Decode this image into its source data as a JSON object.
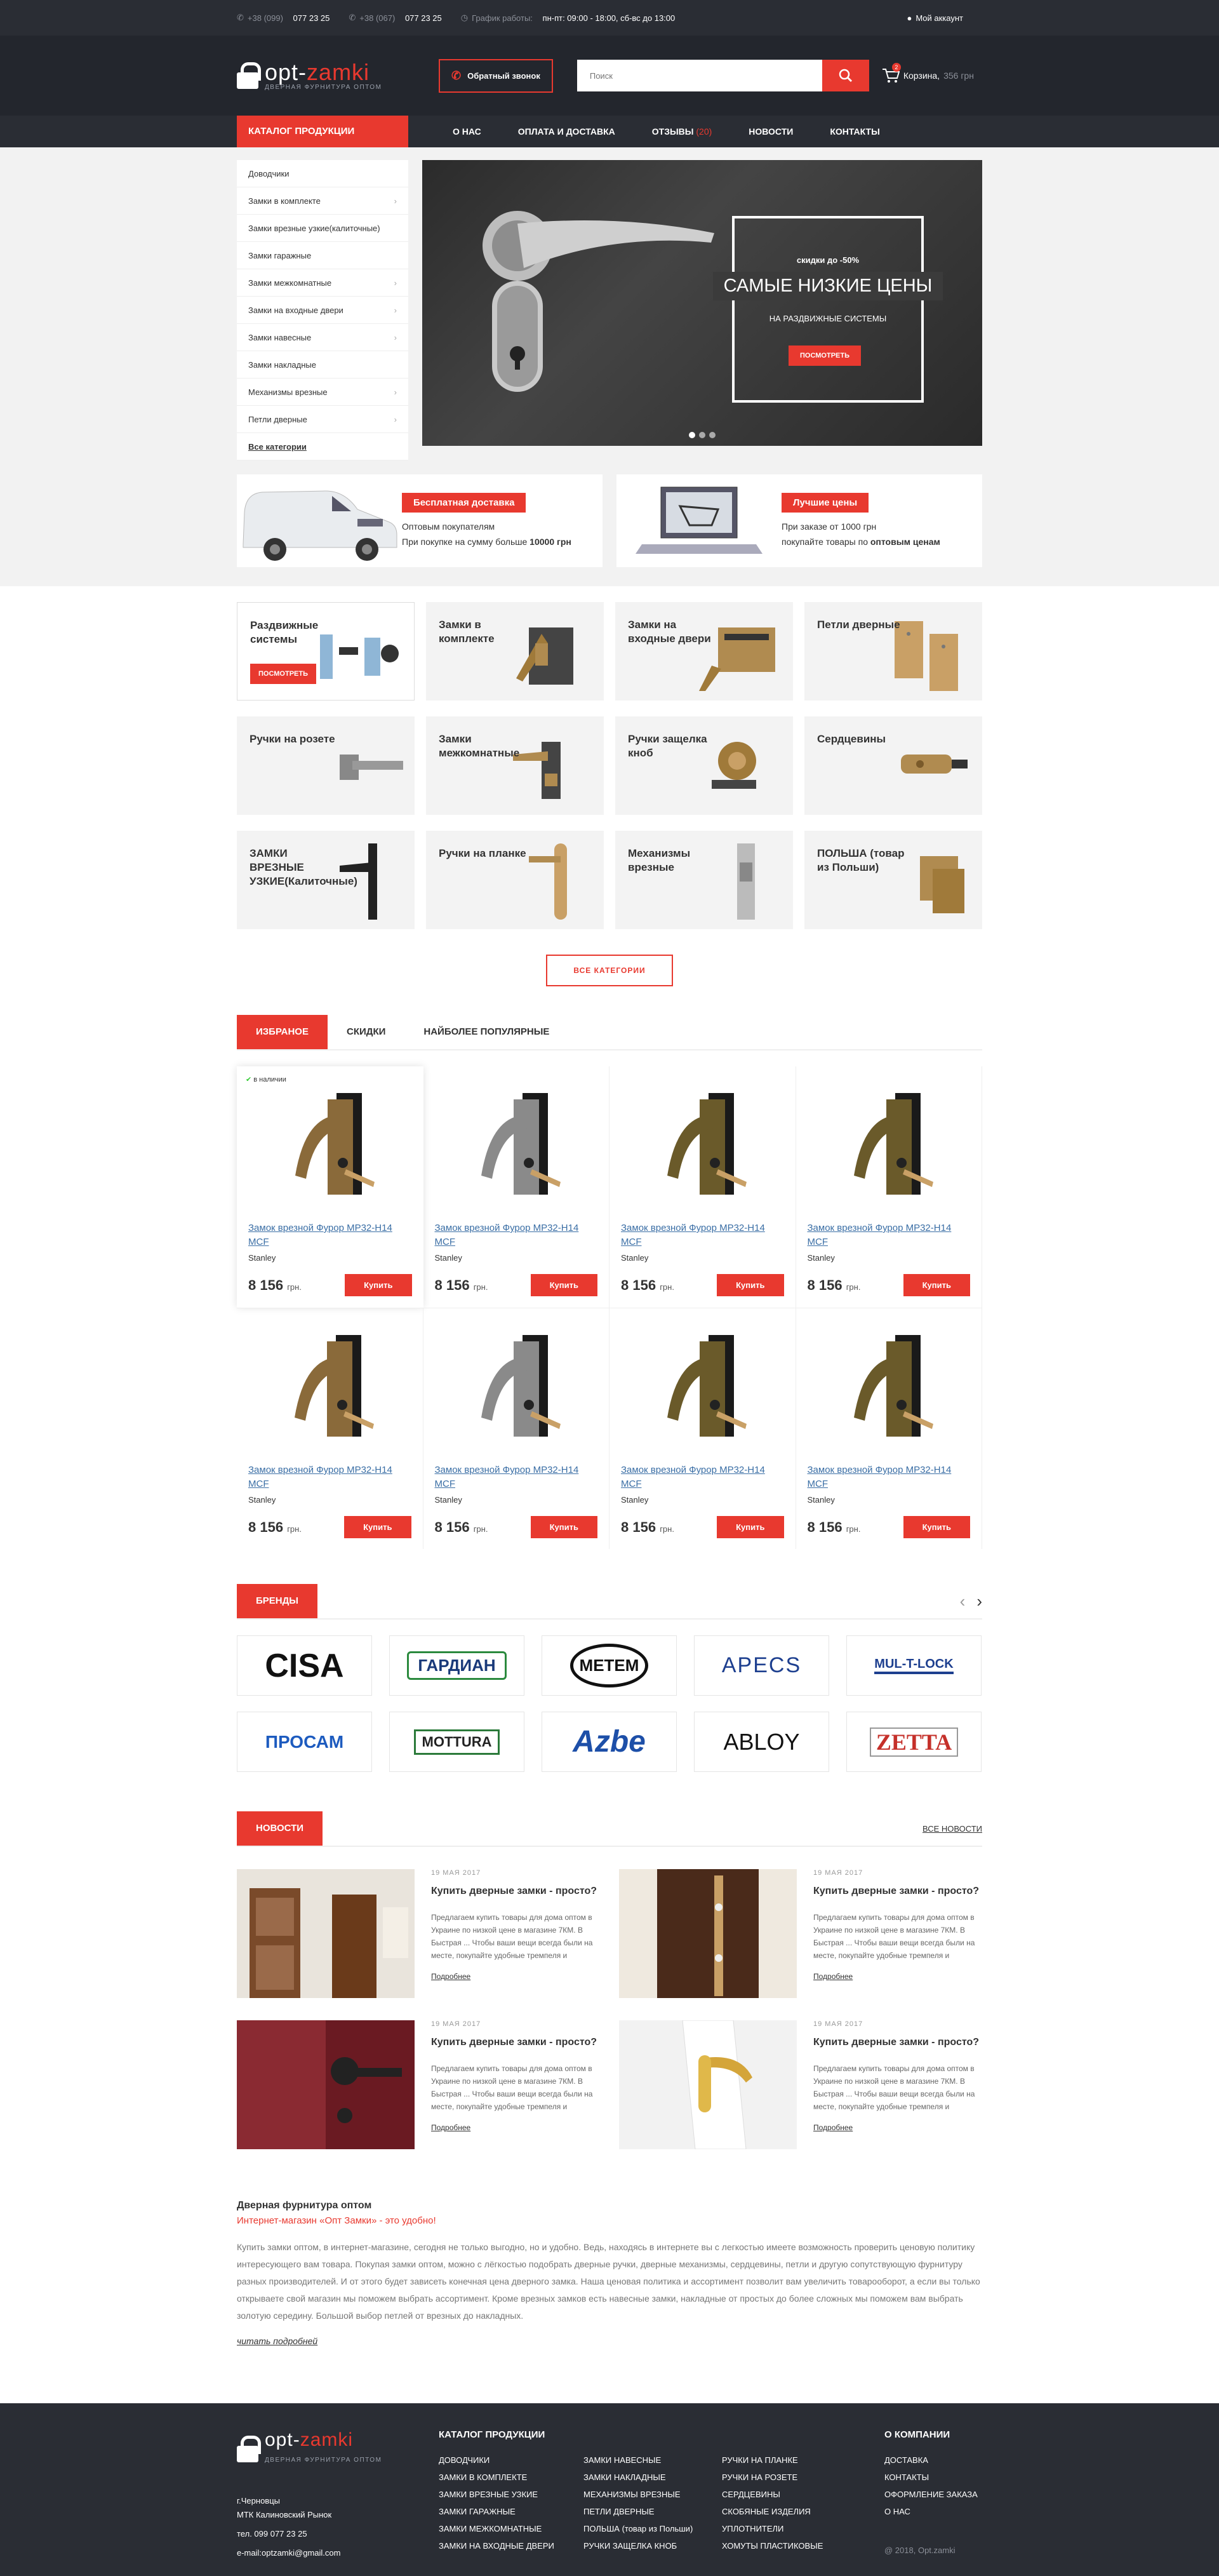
{
  "topbar": {
    "phone1_prefix": "+38 (099)",
    "phone1": "077 23 25",
    "phone2_prefix": "+38 (067)",
    "phone2": "077 23 25",
    "schedule_label": "График работы:",
    "schedule": "пн-пт: 09:00 - 18:00, сб-вс до 13:00",
    "account": "Мой аккаунт"
  },
  "header": {
    "logo_a": "opt-",
    "logo_b": "zamki",
    "logo_sub": "ДВЕРНАЯ ФУРНИТУРА ОПТОМ",
    "callback": "Обратный звонок",
    "search_placeholder": "Поиск",
    "cart_count": "2",
    "cart_label": "Корзина,",
    "cart_sum": "356 грн"
  },
  "nav": {
    "catalog": "КАТАЛОГ ПРОДУКЦИИ",
    "items": [
      "О НАС",
      "ОПЛАТА И ДОСТАВКА",
      "ОТЗЫВЫ",
      "НОВОСТИ",
      "КОНТАКТЫ"
    ],
    "reviews_count": "(20)"
  },
  "sidebar": {
    "items": [
      "Доводчики",
      "Замки в комплекте",
      "Замки врезные узкие(калиточные)",
      "Замки гаражные",
      "Замки межкомнатные",
      "Замки на входные двери",
      "Замки навесные",
      "Замки накладные",
      "Механизмы врезные",
      "Петли дверные"
    ],
    "all": "Все категории"
  },
  "slider": {
    "line1": "скидки до -50%",
    "line2": "САМЫЕ НИЗКИЕ ЦЕНЫ",
    "line3": "НА РАЗДВИЖНЫЕ СИСТЕМЫ",
    "button": "ПОСМОТРЕТЬ"
  },
  "promo": [
    {
      "tag": "Бесплатная доставка",
      "l1": "Оптовым покупателям",
      "l2a": "При покупке на сумму больше ",
      "l2b": "10000 грн"
    },
    {
      "tag": "Лучшие цены",
      "l1": "При заказе от 1000 грн",
      "l2a": "покупайте товары по ",
      "l2b": "оптовым ценам"
    }
  ],
  "categories": {
    "items": [
      "Раздвижные системы",
      "Замки в комплекте",
      "Замки на входные двери",
      "Петли дверные",
      "Ручки на розете",
      "Замки межкомнатные",
      "Ручки защелка кноб",
      "Сердцевины",
      "ЗАМКИ ВРЕЗНЫЕ УЗКИЕ(Калиточные)",
      "Ручки на планке",
      "Механизмы врезные",
      "ПОЛЬША (товар из Польши)"
    ],
    "first_button": "ПОСМОТРЕТЬ",
    "all_button": "ВСЕ КАТЕГОРИИ"
  },
  "tabs": [
    "ИЗБРАНОЕ",
    "СКИДКИ",
    "НАЙБОЛЕЕ ПОПУЛЯРНЫЕ"
  ],
  "products": {
    "stock": "в наличии",
    "items": [
      {
        "name": "Замок врезной Фурор MP32-H14 MCF",
        "brand": "Stanley",
        "price": "8 156",
        "currency": "грн."
      },
      {
        "name": "Замок врезной Фурор MP32-H14 MCF",
        "brand": "Stanley",
        "price": "8 156",
        "currency": "грн."
      },
      {
        "name": "Замок врезной Фурор MP32-H14 MCF",
        "brand": "Stanley",
        "price": "8 156",
        "currency": "грн."
      },
      {
        "name": "Замок врезной Фурор MP32-H14 MCF",
        "brand": "Stanley",
        "price": "8 156",
        "currency": "грн."
      },
      {
        "name": "Замок врезной Фурор MP32-H14 MCF",
        "brand": "Stanley",
        "price": "8 156",
        "currency": "грн."
      },
      {
        "name": "Замок врезной Фурор MP32-H14 MCF",
        "brand": "Stanley",
        "price": "8 156",
        "currency": "грн."
      },
      {
        "name": "Замок врезной Фурор MP32-H14 MCF",
        "brand": "Stanley",
        "price": "8 156",
        "currency": "грн."
      },
      {
        "name": "Замок врезной Фурор MP32-H14 MCF",
        "brand": "Stanley",
        "price": "8 156",
        "currency": "грн."
      }
    ],
    "buy": "Купить"
  },
  "brands": {
    "title": "БРЕНДЫ",
    "items": [
      "CISA",
      "ГАРДИАН",
      "METEM",
      "APECS",
      "MUL-T-LOCK",
      "ПРОСАМ",
      "MOTTURA",
      "Azbe",
      "ABLOY",
      "ZETTA"
    ]
  },
  "news": {
    "title": "НОВОСТИ",
    "all": "ВСЕ НОВОСТИ",
    "items": [
      {
        "date": "19 МАЯ 2017",
        "title": "Купить дверные замки - просто?",
        "excerpt": "Предлагаем купить товары для дома оптом в Украине по низкой цене в магазине 7КМ. В Быстрая ... Чтобы ваши вещи всегда были на месте, покупайте удобные тремпеля и",
        "more": "Подробнее"
      },
      {
        "date": "19 МАЯ 2017",
        "title": "Купить дверные замки - просто?",
        "excerpt": "Предлагаем купить товары для дома оптом в Украине по низкой цене в магазине 7КМ. В Быстрая ... Чтобы ваши вещи всегда были на месте, покупайте удобные тремпеля и",
        "more": "Подробнее"
      },
      {
        "date": "19 МАЯ 2017",
        "title": "Купить дверные замки - просто?",
        "excerpt": "Предлагаем купить товары для дома оптом в Украине по низкой цене в магазине 7КМ. В Быстрая ... Чтобы ваши вещи всегда были на месте, покупайте удобные тремпеля и",
        "more": "Подробнее"
      },
      {
        "date": "19 МАЯ 2017",
        "title": "Купить дверные замки - просто?",
        "excerpt": "Предлагаем купить товары для дома оптом в Украине по низкой цене в магазине 7КМ. В Быстрая ... Чтобы ваши вещи всегда были на месте, покупайте удобные тремпеля и",
        "more": "Подробнее"
      }
    ]
  },
  "seo": {
    "h1": "Дверная фурнитура оптом",
    "h2": "Интернет-магазин «Опт Замки» - это удобно!",
    "text": "Купить замки оптом, в интернет-магазине, сегодня не только выгодно, но и удобно. Ведь, находясь в интернете вы с легкостью имеете возможность проверить ценовую политику интересующего вам товара. Покупая замки оптом, можно с лёгкостью подобрать дверные ручки, дверные механизмы, сердцевины, петли и другую сопутствующую фурнитуру разных производителей. И от этого будет зависеть конечная цена дверного замка. Наша ценовая политика и ассортимент позволит вам увеличить товарооборот, а если вы только открываете свой магазин мы поможем выбрать ассортимент. Кроме врезных замков есть навесные замки, накладные от простых до более сложных мы поможем вам выбрать золотую середину. Большой выбор петлей от врезных до накладных.",
    "more": "читать подробней"
  },
  "footer": {
    "city": "г.Черновцы",
    "address": "МТК Калиновский Рынок",
    "phone": "тел. 099 077 23 25",
    "email": "e-mail:optzamki@gmail.com",
    "catalog_title": "КАТАЛОГ ПРОДУКЦИИ",
    "col1": [
      "ДОВОДЧИКИ",
      "ЗАМКИ В КОМПЛЕКТЕ",
      "ЗАМКИ ВРЕЗНЫЕ УЗКИЕ",
      "ЗАМКИ ГАРАЖНЫЕ",
      "ЗАМКИ МЕЖКОМНАТНЫЕ",
      "ЗАМКИ НА ВХОДНЫЕ ДВЕРИ"
    ],
    "col2": [
      "ЗАМКИ НАВЕСНЫЕ",
      "ЗАМКИ НАКЛАДНЫЕ",
      "МЕХАНИЗМЫ ВРЕЗНЫЕ",
      "ПЕТЛИ ДВЕРНЫЕ",
      "ПОЛЬША (товар из Польши)",
      "РУЧКИ ЗАЩЕЛКА КНОБ"
    ],
    "col3": [
      "РУЧКИ НА ПЛАНКЕ",
      "РУЧКИ НА РОЗЕТЕ",
      "СЕРДЦЕВИНЫ",
      "СКОБЯНЫЕ ИЗДЕЛИЯ",
      "УПЛОТНИТЕЛИ",
      "ХОМУТЫ ПЛАСТИКОВЫЕ"
    ],
    "company_title": "О КОМПАНИИ",
    "company": [
      "ДОСТАВКА",
      "КОНТАКТЫ",
      "ОФОРМЛЕНИЕ ЗАКАЗА",
      "О НАС"
    ],
    "copyright": "@ 2018, Opt.zamki"
  }
}
